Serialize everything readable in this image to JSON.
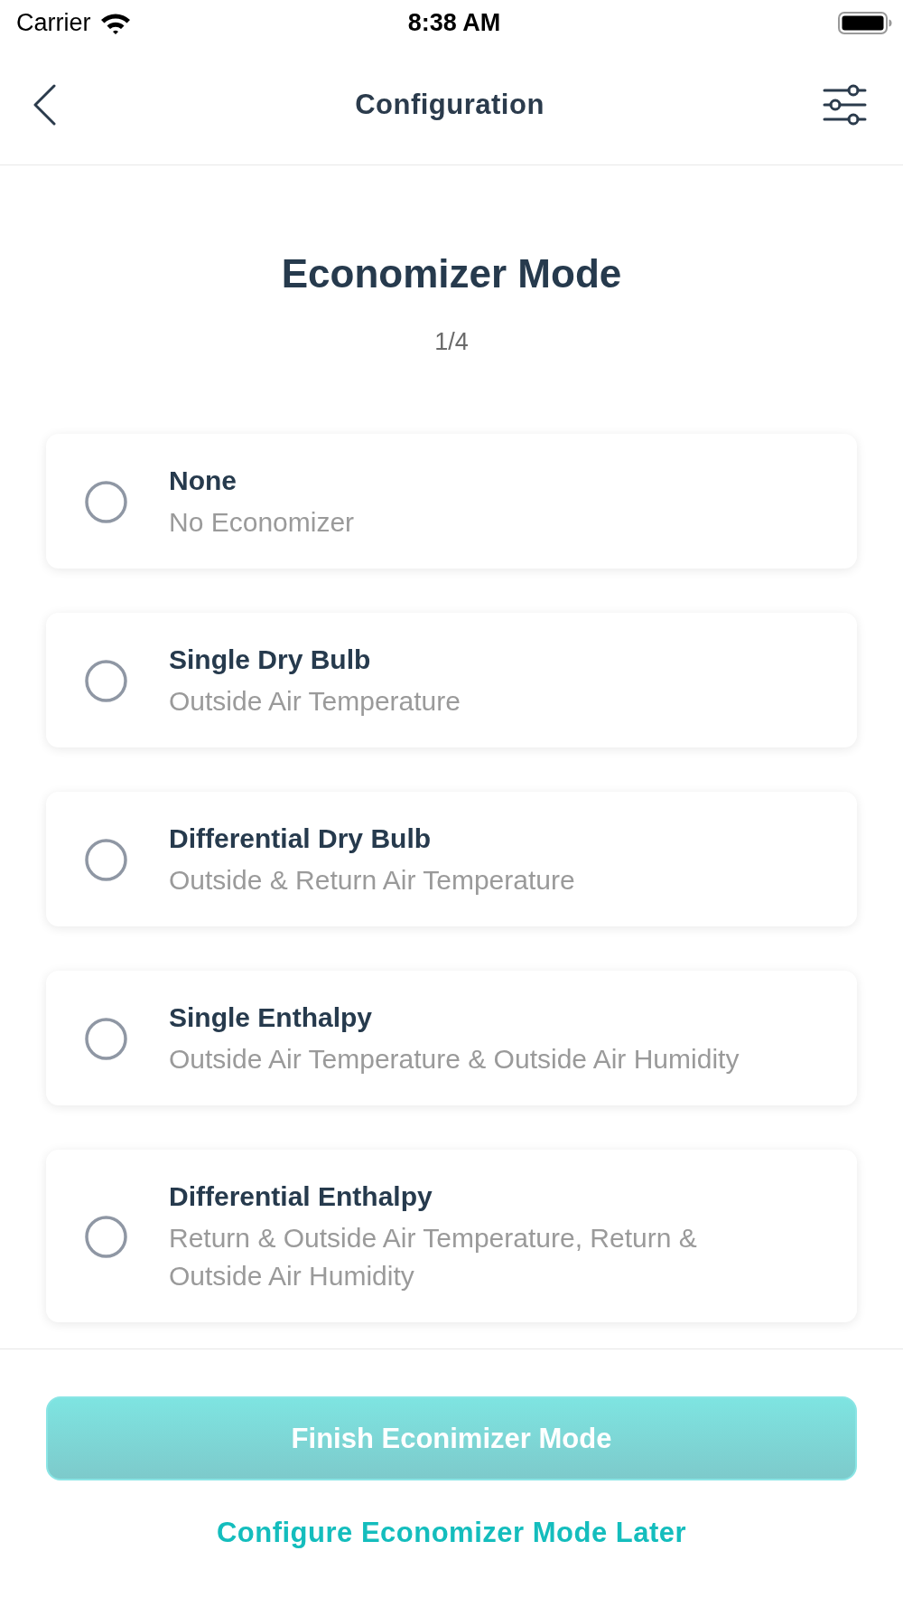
{
  "status_bar": {
    "carrier": "Carrier",
    "time": "8:38 AM"
  },
  "nav_bar": {
    "title": "Configuration"
  },
  "header": {
    "title": "Economizer Mode",
    "step": "1/4"
  },
  "options": [
    {
      "title": "None",
      "subtitle": "No Economizer",
      "selected": false
    },
    {
      "title": "Single Dry Bulb",
      "subtitle": "Outside Air Temperature",
      "selected": false
    },
    {
      "title": "Differential Dry Bulb",
      "subtitle": "Outside & Return Air Temperature",
      "selected": false
    },
    {
      "title": "Single Enthalpy",
      "subtitle": "Outside Air Temperature & Outside Air Humidity",
      "selected": false
    },
    {
      "title": "Differential Enthalpy",
      "subtitle": "Return & Outside Air Temperature, Return & Outside Air Humidity",
      "selected": false
    }
  ],
  "primary_button": {
    "label": "Finish Econimizer Mode",
    "disabled": true
  },
  "secondary_link": {
    "label": "Configure Economizer Mode Later"
  }
}
